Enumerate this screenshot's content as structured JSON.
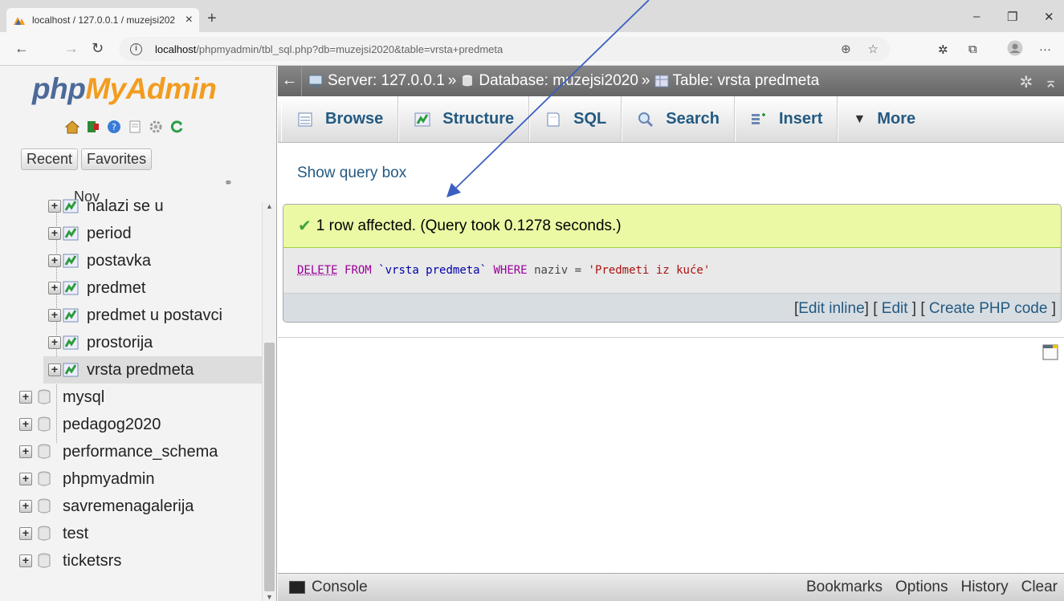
{
  "browser": {
    "tab_title": "localhost / 127.0.0.1 / muzejsi202",
    "tab_close": "×",
    "new_tab": "+",
    "minimize": "–",
    "restore": "❐",
    "close": "✕",
    "back": "←",
    "forward": "→",
    "reload": "↻",
    "url_host": "localhost",
    "url_path": "/phpmyadmin/tbl_sql.php?db=muzejsi2020&table=vrsta+predmeta",
    "menu": "···"
  },
  "nav": {
    "logo_part1": "php",
    "logo_part2": "MyAdmin",
    "recent_tab": "Recent",
    "favorites_tab": "Favorites",
    "partial_item": "Nov",
    "tables": [
      {
        "name": "nalazi se u"
      },
      {
        "name": "period"
      },
      {
        "name": "postavka"
      },
      {
        "name": "predmet"
      },
      {
        "name": "predmet u postavci"
      },
      {
        "name": "prostorija"
      },
      {
        "name": "vrsta predmeta"
      }
    ],
    "databases": [
      {
        "name": "mysql"
      },
      {
        "name": "pedagog2020"
      },
      {
        "name": "performance_schema"
      },
      {
        "name": "phpmyadmin"
      },
      {
        "name": "savremenagalerija"
      },
      {
        "name": "test"
      },
      {
        "name": "ticketsrs"
      }
    ]
  },
  "breadcrumb": {
    "back": "←",
    "server": "Server: 127.0.0.1",
    "database": "Database: muzejsi2020",
    "table": "Table: vrsta predmeta",
    "sep": "»"
  },
  "menu": {
    "browse": "Browse",
    "structure": "Structure",
    "sql": "SQL",
    "search": "Search",
    "insert": "Insert",
    "more": "More"
  },
  "main": {
    "show_query_box": "Show query box",
    "success_message": "1 row affected. (Query took 0.1278 seconds.)",
    "sql": {
      "kw_delete": "DELETE",
      "kw_from": "FROM",
      "table": "`vrsta predmeta`",
      "kw_where": "WHERE",
      "column": "naziv",
      "op": "=",
      "value": "'Predmeti iz kuće'"
    },
    "edit_inline": "Edit inline",
    "edit": "Edit",
    "create_php": "Create PHP code"
  },
  "console": {
    "label": "Console",
    "bookmarks": "Bookmarks",
    "options": "Options",
    "history": "History",
    "clear": "Clear"
  },
  "colors": {
    "link_blue": "#235a81",
    "success_bg": "#ebf8a4",
    "annotation_arrow": "#3b5fc0"
  }
}
